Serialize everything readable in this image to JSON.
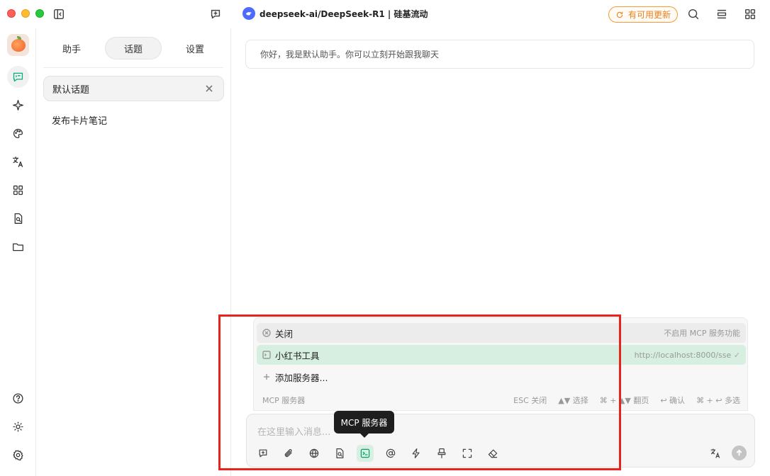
{
  "titlebar": {
    "model_name": "deepseek-ai/DeepSeek-R1 | 硅基流动",
    "update_label": "有可用更新",
    "colors": {
      "update_accent": "#e8811e",
      "model_logo": "#4d6bfe"
    }
  },
  "rail": {
    "items": [
      "chat-icon",
      "sparkle-icon",
      "palette-icon",
      "translate-icon",
      "apps-icon",
      "doc-search-icon",
      "folder-icon"
    ],
    "bottom": [
      "help-icon",
      "theme-icon",
      "settings-icon"
    ],
    "accent": "#00b07a"
  },
  "panel": {
    "tabs": [
      {
        "label": "助手"
      },
      {
        "label": "话题"
      },
      {
        "label": "设置"
      }
    ],
    "active_topic": "默认话题",
    "topics": [
      "发布卡片笔记"
    ]
  },
  "chat": {
    "greeting": "你好，我是默认助手。你可以立刻开始跟我聊天"
  },
  "mcp": {
    "rows": [
      {
        "label": "关闭",
        "hint": "不启用 MCP 服务功能"
      },
      {
        "label": "小红书工具",
        "hint": "http://localhost:8000/sse"
      },
      {
        "label": "添加服务器..."
      }
    ],
    "footer_title": "MCP 服务器",
    "keys": [
      "ESC 关闭",
      "▲▼ 选择",
      "⌘ + ▲▼ 翻页",
      "↩ 确认",
      "⌘ + ↩ 多选"
    ]
  },
  "input": {
    "placeholder": "在这里输入消息...",
    "tooltip": "MCP 服务器"
  }
}
